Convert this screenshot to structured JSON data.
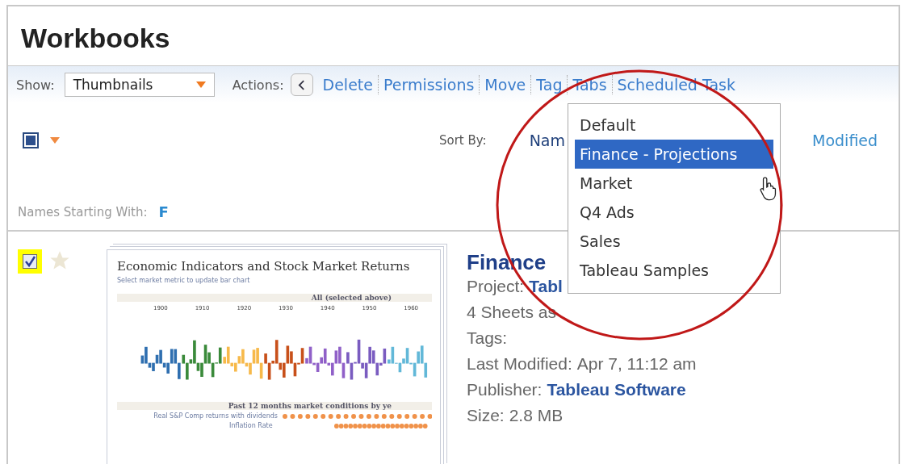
{
  "page": {
    "title": "Workbooks"
  },
  "toolbar": {
    "show_label": "Show:",
    "show_value": "Thumbnails",
    "actions_label": "Actions:",
    "actions": [
      "Delete",
      "Permissions",
      "Move",
      "Tag",
      "Tabs",
      "Scheduled Task"
    ]
  },
  "selection": {
    "select_all_checked": true
  },
  "sort": {
    "label": "Sort By:",
    "options": [
      "Nam",
      "Modified"
    ]
  },
  "filter": {
    "label": "Names Starting With:",
    "letter": "F"
  },
  "move_menu": {
    "items": [
      {
        "label": "Default",
        "selected": false
      },
      {
        "label": "Finance - Projections",
        "selected": true
      },
      {
        "label": "Market",
        "selected": false
      },
      {
        "label": "Q4 Ads",
        "selected": false
      },
      {
        "label": "Sales",
        "selected": false
      },
      {
        "label": "Tableau Samples",
        "selected": false
      }
    ]
  },
  "workbook": {
    "checked": true,
    "favorite": false,
    "name": "Finance",
    "thumbnail": {
      "title": "Economic Indicators and Stock Market Returns",
      "subtitle": "Select market metric to update bar chart",
      "section_1": "All (selected above)",
      "years": [
        "1900",
        "1910",
        "1920",
        "1930",
        "1940",
        "1950",
        "1960"
      ],
      "section_2": "Past 12 months market conditions by ye",
      "row_labels": [
        "Real S&P Comp returns with dividends",
        "Inflation Rate"
      ]
    },
    "details": [
      {
        "label": "Project:",
        "value": "Tabl"
      },
      {
        "label": "4 Sheets as"
      },
      {
        "label": "Tags:"
      },
      {
        "label": "Last Modified:",
        "value": "Apr 7, 11:12 am"
      },
      {
        "label": "Publisher:",
        "value": "Tableau Software"
      },
      {
        "label": "Size:",
        "value": "2.8 MB"
      }
    ]
  }
}
